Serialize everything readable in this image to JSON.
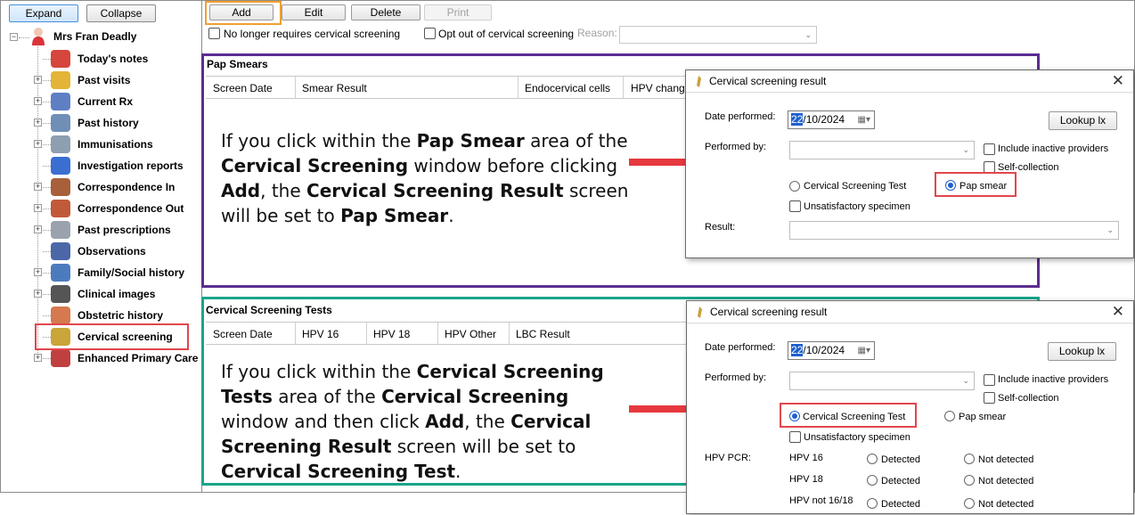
{
  "tree": {
    "expand_label": "Expand",
    "collapse_label": "Collapse",
    "root_label": "Mrs Fran Deadly",
    "items": [
      {
        "label": "Today's notes",
        "icon": "calendar-icon",
        "color": "#d6463c",
        "expandable": false
      },
      {
        "label": "Past visits",
        "icon": "folder-icon",
        "color": "#e3b437",
        "expandable": true
      },
      {
        "label": "Current Rx",
        "icon": "pill-icon",
        "color": "#5f7fc4",
        "expandable": true
      },
      {
        "label": "Past history",
        "icon": "doctor-icon",
        "color": "#6f8fb6",
        "expandable": true
      },
      {
        "label": "Immunisations",
        "icon": "syringe-icon",
        "color": "#8f9fb2",
        "expandable": true
      },
      {
        "label": "Investigation reports",
        "icon": "flask-icon",
        "color": "#3a6fd1",
        "expandable": false
      },
      {
        "label": "Correspondence In",
        "icon": "inbox-icon",
        "color": "#a7603a",
        "expandable": true
      },
      {
        "label": "Correspondence Out",
        "icon": "outbox-icon",
        "color": "#c05a3a",
        "expandable": true
      },
      {
        "label": "Past prescriptions",
        "icon": "prescription-icon",
        "color": "#9aa3ad",
        "expandable": true
      },
      {
        "label": "Observations",
        "icon": "thermometer-icon",
        "color": "#4b67a8",
        "expandable": false
      },
      {
        "label": "Family/Social history",
        "icon": "family-icon",
        "color": "#4c7bbd",
        "expandable": true
      },
      {
        "label": "Clinical images",
        "icon": "camera-icon",
        "color": "#555555",
        "expandable": true
      },
      {
        "label": "Obstetric history",
        "icon": "pregnancy-icon",
        "color": "#d6794e",
        "expandable": false
      },
      {
        "label": "Cervical screening",
        "icon": "cervical-screening-icon",
        "color": "#c9a53a",
        "expandable": false
      },
      {
        "label": "Enhanced Primary Care",
        "icon": "epc-icon",
        "color": "#c04040",
        "expandable": true
      }
    ]
  },
  "toolbar": {
    "add_label": "Add",
    "edit_label": "Edit",
    "delete_label": "Delete",
    "print_label": "Print"
  },
  "options": {
    "no_longer_requires": "No longer requires cervical screening",
    "opt_out": "Opt out of cervical screening",
    "reason_label": "Reason:"
  },
  "pap_section": {
    "title": "Pap Smears",
    "columns": [
      "Screen Date",
      "Smear Result",
      "Endocervical cells",
      "HPV change"
    ]
  },
  "cst_section": {
    "title": "Cervical Screening Tests",
    "columns": [
      "Screen Date",
      "HPV 16",
      "HPV 18",
      "HPV Other",
      "LBC Result"
    ]
  },
  "callouts": {
    "pap": {
      "p1": "If you click within the ",
      "b1": "Pap Smear",
      "p2": " area of the ",
      "b2": "Cervical Screening",
      "p3": " window before clicking ",
      "b3": "Add",
      "p4": ", the ",
      "b4": "Cervical Screening Result",
      "p5": " screen will be set to ",
      "b5": "Pap Smear",
      "p6": "."
    },
    "cst": {
      "p1": "If you click within the ",
      "b1": "Cervical Screening Tests",
      "p2": " area of the ",
      "b2": "Cervical Screening",
      "p3": " window and then click ",
      "b3": "Add",
      "p4": ", the ",
      "b4": "Cervical Screening Result",
      "p5": " screen will be set to ",
      "b5": "Cervical Screening Test",
      "p6": "."
    }
  },
  "dialog_pap": {
    "title": "Cervical screening result",
    "date_label": "Date performed:",
    "date_day": "22",
    "date_rest": "/10/2024",
    "lookup_label": "Lookup lx",
    "performed_by_label": "Performed by:",
    "include_inactive": "Include inactive providers",
    "self_collection": "Self-collection",
    "radio_cst": "Cervical Screening Test",
    "radio_pap": "Pap smear",
    "selected": "pap",
    "unsatisfactory": "Unsatisfactory specimen",
    "result_label": "Result:"
  },
  "dialog_cst": {
    "title": "Cervical screening result",
    "date_label": "Date performed:",
    "date_day": "22",
    "date_rest": "/10/2024",
    "lookup_label": "Lookup lx",
    "performed_by_label": "Performed by:",
    "include_inactive": "Include inactive providers",
    "self_collection": "Self-collection",
    "radio_cst": "Cervical Screening Test",
    "radio_pap": "Pap smear",
    "selected": "cst",
    "unsatisfactory": "Unsatisfactory specimen",
    "hpv_pcr_label": "HPV PCR:",
    "hpv_rows": [
      {
        "label": "HPV 16",
        "detected": "Detected",
        "not_detected": "Not detected"
      },
      {
        "label": "HPV 18",
        "detected": "Detected",
        "not_detected": "Not detected"
      },
      {
        "label": "HPV not 16/18",
        "detected": "Detected",
        "not_detected": "Not detected"
      }
    ]
  },
  "colors": {
    "pap_frame": "#5c2d91",
    "cst_frame": "#1aa58a",
    "highlight_red": "#e0474c",
    "add_highlight": "#f0a030",
    "arrow": "#e6383f"
  }
}
